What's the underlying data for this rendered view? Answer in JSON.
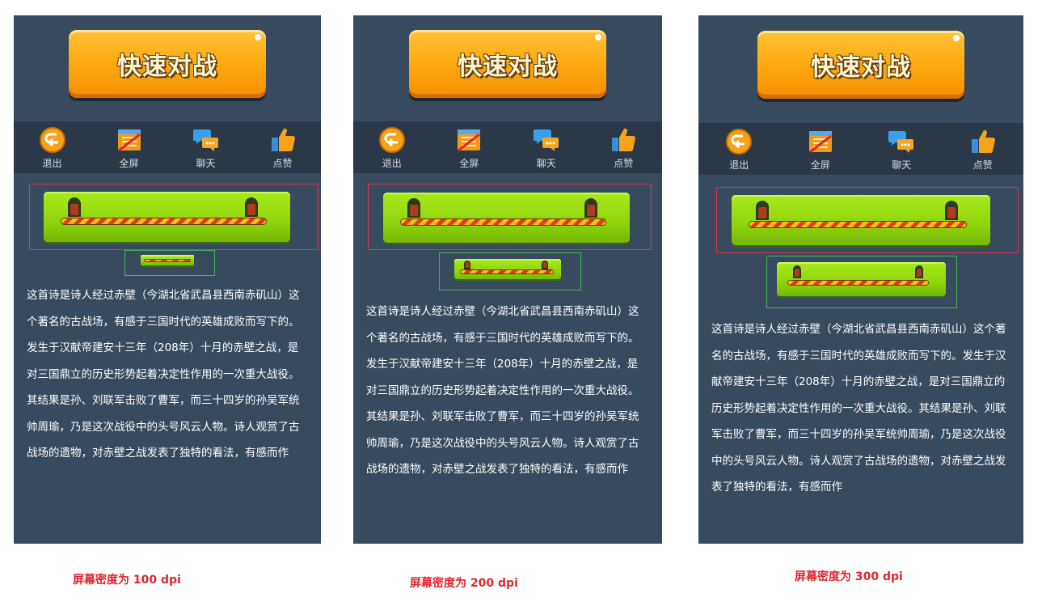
{
  "panels": [
    {
      "button_label": "快速对战",
      "tools": [
        {
          "icon": "exit-icon",
          "label": "退出"
        },
        {
          "icon": "fullscreen-icon",
          "label": "全屏"
        },
        {
          "icon": "chat-icon",
          "label": "聊天"
        },
        {
          "icon": "thumbs-up-icon",
          "label": "点赞"
        }
      ],
      "poem": "这首诗是诗人经过赤壁（今湖北省武昌县西南赤矶山）这个著名的古战场，有感于三国时代的英雄成败而写下的。发生于汉献帝建安十三年（208年）十月的赤壁之战，是对三国鼎立的历史形势起着决定性作用的一次重大战役。其结果是孙、刘联军击败了曹军，而三十四岁的孙吴军统帅周瑜，乃是这次战役中的头号风云人物。诗人观赏了古战场的遗物，对赤壁之战发表了独特的看法，有感而作",
      "caption": "屏幕密度为 100 dpi"
    },
    {
      "button_label": "快速对战",
      "tools": [
        {
          "icon": "exit-icon",
          "label": "退出"
        },
        {
          "icon": "fullscreen-icon",
          "label": "全屏"
        },
        {
          "icon": "chat-icon",
          "label": "聊天"
        },
        {
          "icon": "thumbs-up-icon",
          "label": "点赞"
        }
      ],
      "poem": "这首诗是诗人经过赤壁（今湖北省武昌县西南赤矶山）这个著名的古战场，有感于三国时代的英雄成败而写下的。发生于汉献帝建安十三年（208年）十月的赤壁之战，是对三国鼎立的历史形势起着决定性作用的一次重大战役。其结果是孙、刘联军击败了曹军，而三十四岁的孙吴军统帅周瑜，乃是这次战役中的头号风云人物。诗人观赏了古战场的遗物，对赤壁之战发表了独特的看法，有感而作",
      "caption": "屏幕密度为 200 dpi"
    },
    {
      "button_label": "快速对战",
      "tools": [
        {
          "icon": "exit-icon",
          "label": "退出"
        },
        {
          "icon": "fullscreen-icon",
          "label": "全屏"
        },
        {
          "icon": "chat-icon",
          "label": "聊天"
        },
        {
          "icon": "thumbs-up-icon",
          "label": "点赞"
        }
      ],
      "poem": "这首诗是诗人经过赤壁（今湖北省武昌县西南赤矶山）这个著名的古战场，有感于三国时代的英雄成败而写下的。发生于汉献帝建安十三年（208年）十月的赤壁之战，是对三国鼎立的历史形势起着决定性作用的一次重大战役。其结果是孙、刘联军击败了曹军，而三十四岁的孙吴军统帅周瑜，乃是这次战役中的头号风云人物。诗人观赏了古战场的遗物，对赤壁之战发表了独特的看法，有感而作",
      "caption": "屏幕密度为 300 dpi"
    }
  ]
}
